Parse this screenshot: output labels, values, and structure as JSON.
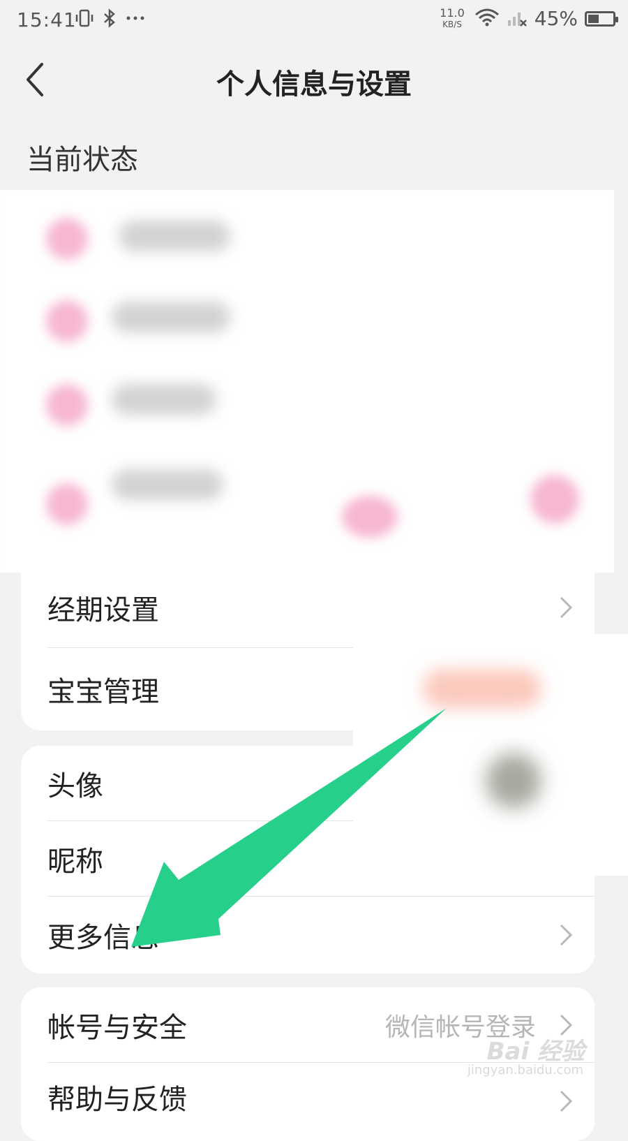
{
  "status_bar": {
    "time": "15:41",
    "icons": [
      "vibrate-icon",
      "bluetooth-icon",
      "more-dots-icon"
    ],
    "net_speed_value": "11.0",
    "net_speed_unit": "KB/S",
    "battery_percent_text": "45%",
    "battery_level": 0.45
  },
  "nav": {
    "title": "个人信息与设置"
  },
  "section": {
    "current_status": "当前状态"
  },
  "group1": {
    "items": [
      {
        "label": "经期设置"
      },
      {
        "label": "宝宝管理"
      }
    ]
  },
  "group2": {
    "items": [
      {
        "label": "头像"
      },
      {
        "label": "昵称"
      },
      {
        "label": "更多信息"
      }
    ]
  },
  "group3": {
    "items": [
      {
        "label": "帐号与安全",
        "value": "微信帐号登录"
      },
      {
        "label": "帮助与反馈"
      }
    ]
  },
  "watermark": {
    "brand": "Bai 经验",
    "url": "jingyan.baidu.com"
  },
  "colors": {
    "arrow": "#27d08a",
    "accent_pink": "#f7b7d2",
    "background": "#f2f2f4"
  }
}
